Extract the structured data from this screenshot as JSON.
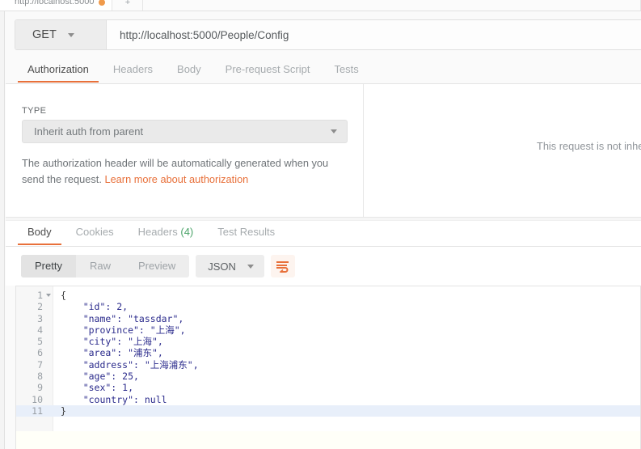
{
  "window": {
    "tab": {
      "label": "http://localhost:5000",
      "unsaved_indicator": "unsaved-dot",
      "new_tab_label": "+"
    }
  },
  "request": {
    "method": "GET",
    "method_caret": "chevron-down-icon",
    "url": "http://localhost:5000/People/Config",
    "tabs": [
      {
        "label": "Authorization",
        "active": true
      },
      {
        "label": "Headers",
        "active": false
      },
      {
        "label": "Body",
        "active": false
      },
      {
        "label": "Pre-request Script",
        "active": false
      },
      {
        "label": "Tests",
        "active": false
      }
    ]
  },
  "authorization": {
    "type_label": "TYPE",
    "type_value": "Inherit auth from parent",
    "help_text": "The authorization header will be automatically generated when you send the request. ",
    "help_link": "Learn more about authorization",
    "not_inherited_text": "This request is not inhe"
  },
  "response": {
    "tabs": [
      {
        "label": "Body",
        "count": "",
        "active": true
      },
      {
        "label": "Cookies",
        "count": "",
        "active": false
      },
      {
        "label": "Headers",
        "count": "(4)",
        "active": false
      },
      {
        "label": "Test Results",
        "count": "",
        "active": false
      }
    ],
    "view_modes": [
      {
        "label": "Pretty",
        "active": true
      },
      {
        "label": "Raw",
        "active": false
      },
      {
        "label": "Preview",
        "active": false
      }
    ],
    "format": "JSON",
    "format_caret": "chevron-down-icon",
    "wrap_icon": "word-wrap-icon"
  },
  "body": {
    "lines": [
      {
        "no": "1",
        "text": "{",
        "fold": true,
        "active": false
      },
      {
        "no": "2",
        "text": "    \"id\": 2,",
        "fold": false,
        "active": false
      },
      {
        "no": "3",
        "text": "    \"name\": \"tassdar\",",
        "fold": false,
        "active": false
      },
      {
        "no": "4",
        "text": "    \"province\": \"上海\",",
        "fold": false,
        "active": false
      },
      {
        "no": "5",
        "text": "    \"city\": \"上海\",",
        "fold": false,
        "active": false
      },
      {
        "no": "6",
        "text": "    \"area\": \"浦东\",",
        "fold": false,
        "active": false
      },
      {
        "no": "7",
        "text": "    \"address\": \"上海浦东\",",
        "fold": false,
        "active": false
      },
      {
        "no": "8",
        "text": "    \"age\": 25,",
        "fold": false,
        "active": false
      },
      {
        "no": "9",
        "text": "    \"sex\": 1,",
        "fold": false,
        "active": false
      },
      {
        "no": "10",
        "text": "    \"country\": null",
        "fold": false,
        "active": false
      },
      {
        "no": "11",
        "text": "}",
        "fold": false,
        "active": true
      }
    ]
  },
  "colors": {
    "accent": "#e8703a",
    "unsaved": "#f09a4b",
    "count_green": "#4ca46a",
    "json_text": "#2b2b8c",
    "active_line": "#e8effa"
  }
}
